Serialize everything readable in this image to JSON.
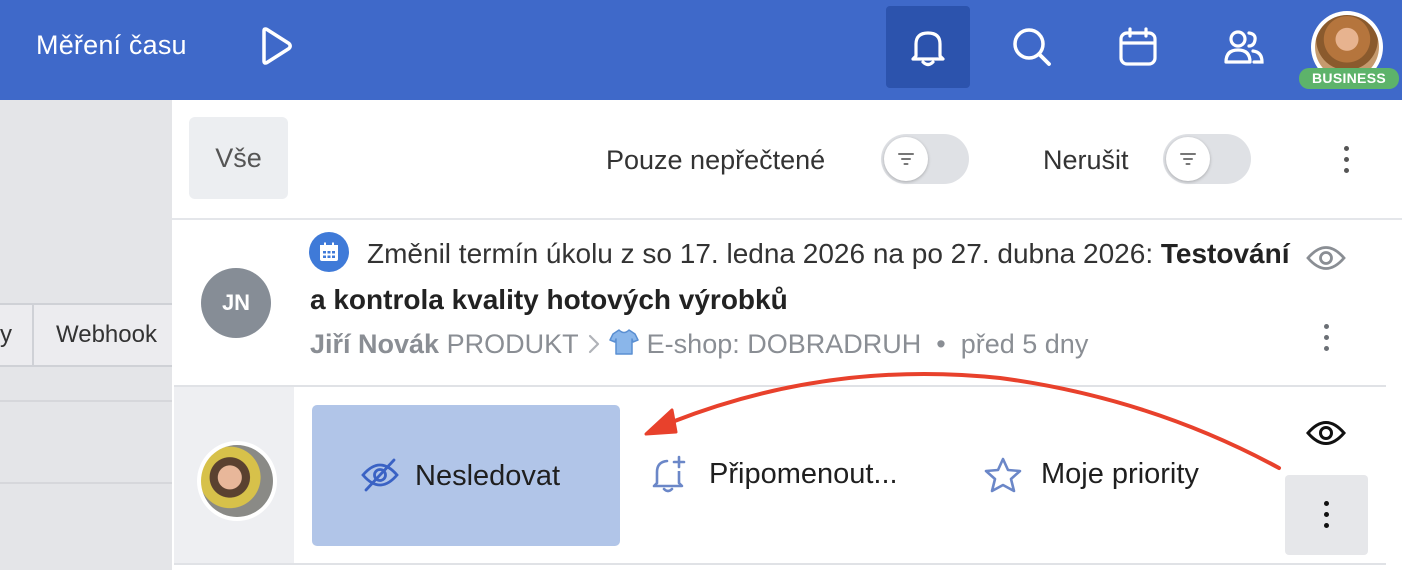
{
  "topbar": {
    "title": "Měření času",
    "icons": [
      "play-icon",
      "bell-icon",
      "search-icon",
      "calendar-icon",
      "users-icon"
    ],
    "plan_badge": "BUSINESS",
    "colors": {
      "bar": "#3f69c9",
      "active": "#2c53ad",
      "badge": "#5db36a"
    }
  },
  "left_panel": {
    "cells": [
      "y",
      "Webhook"
    ]
  },
  "notifications": {
    "filters": {
      "all_label": "Vše",
      "unread_label": "Pouze nepřečtené",
      "dnd_label": "Nerušit"
    },
    "items": [
      {
        "avatar_initials": "JN",
        "text": "Změnil termín úkolu z so 17. ledna 2026 na po 27. dubna 2026: ",
        "task": "Testování a kontrola kvality hotových výrobků",
        "author": "Jiří Novák",
        "category": "PRODUKT",
        "project": "E-shop: DOBRADRUH",
        "time": "před 5 dny"
      }
    ],
    "context_menu": {
      "unfollow": "Nesledovat",
      "remind": "Připomenout...",
      "priority": "Moje priority"
    },
    "annotation_color": "#e8412c"
  }
}
